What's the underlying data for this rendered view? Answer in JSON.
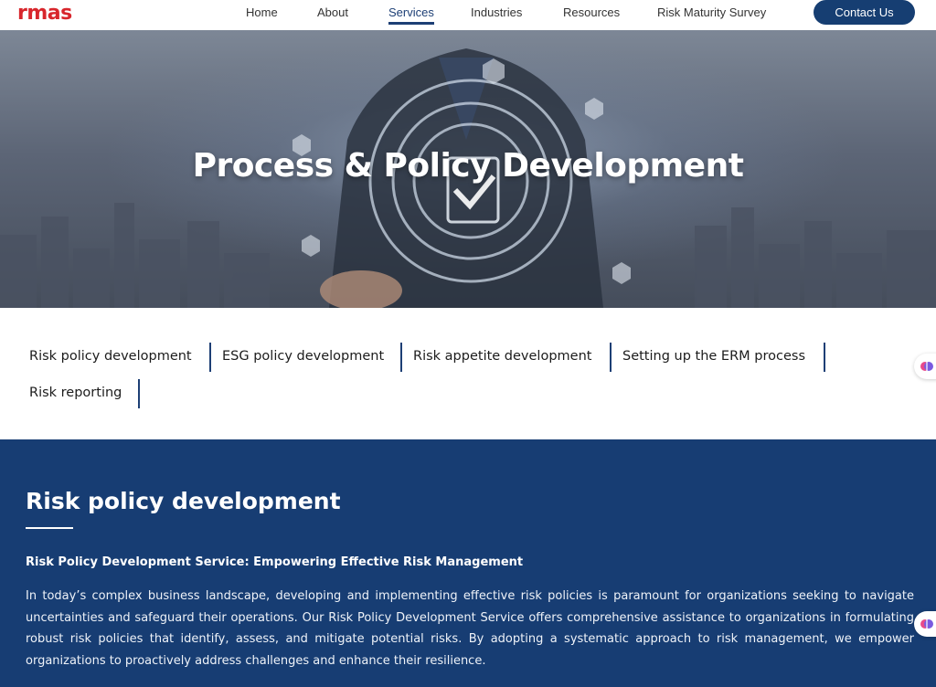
{
  "header": {
    "logo_text": "rmas",
    "nav": [
      {
        "label": "Home"
      },
      {
        "label": "About"
      },
      {
        "label": "Services",
        "active": true
      },
      {
        "label": "Industries"
      },
      {
        "label": "Resources"
      },
      {
        "label": "Risk Maturity Survey"
      }
    ],
    "contact_label": "Contact Us"
  },
  "hero": {
    "title": "Process & Policy Development"
  },
  "tabs": [
    {
      "label": "Risk policy development"
    },
    {
      "label": "ESG policy development"
    },
    {
      "label": "Risk appetite development"
    },
    {
      "label": "Setting up the ERM process"
    },
    {
      "label": "Risk reporting"
    }
  ],
  "section": {
    "title": "Risk policy development",
    "subhead": "Risk Policy Development Service: Empowering Effective Risk Management",
    "body": "In today’s complex business landscape, developing and implementing effective risk policies is paramount for organizations seeking to navigate uncertainties and safeguard their operations. Our Risk Policy Development Service offers comprehensive assistance to organizations in formulating robust risk policies that identify, assess, and mitigate potential risks. By adopting a systematic approach to risk management, we empower organizations to proactively address challenges and enhance their resilience."
  },
  "colors": {
    "brand_blue": "#173d73",
    "brand_red": "#d8262c",
    "text_dark": "#1c1c1c"
  }
}
